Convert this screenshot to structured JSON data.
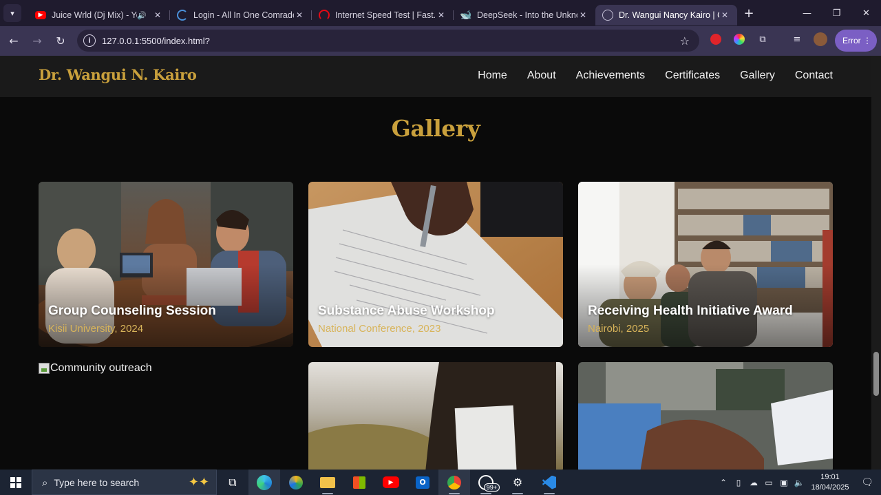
{
  "browser": {
    "tabs": [
      {
        "title": "Juice Wrld (Dj Mix) - YouTube",
        "icon": "youtube-icon",
        "color": "#ff0000",
        "audio": true
      },
      {
        "title": "Login - All In One Comrade",
        "icon": "loading-icon",
        "color": "#4a90d9",
        "audio": false
      },
      {
        "title": "Internet Speed Test | Fast.com",
        "icon": "speedometer-icon",
        "color": "#e50914",
        "audio": false
      },
      {
        "title": "DeepSeek - Into the Unknown",
        "icon": "deepseek-icon",
        "color": "#4d6bfe",
        "audio": false
      },
      {
        "title": "Dr. Wangui Nancy Kairo | Counselor",
        "icon": "globe-icon",
        "color": "#9aa0b0",
        "audio": false,
        "active": true
      }
    ],
    "url": "127.0.0.1:5500/index.html?",
    "profile_status": "Error"
  },
  "site": {
    "brand": "Dr. Wangui N. Kairo",
    "nav": [
      "Home",
      "About",
      "Achievements",
      "Certificates",
      "Gallery",
      "Contact"
    ],
    "section_title": "Gallery",
    "gallery": [
      {
        "title": "Group Counseling Session",
        "subtitle": "Kisii University, 2024"
      },
      {
        "title": "Substance Abuse Workshop",
        "subtitle": "National Conference, 2023"
      },
      {
        "title": "Receiving Health Initiative Award",
        "subtitle": "Nairobi, 2025"
      },
      {
        "alt": "Community outreach"
      }
    ]
  },
  "taskbar": {
    "search_placeholder": "Type here to search",
    "whatsapp_badge": "99+",
    "time": "19:01",
    "date": "18/04/2025"
  }
}
